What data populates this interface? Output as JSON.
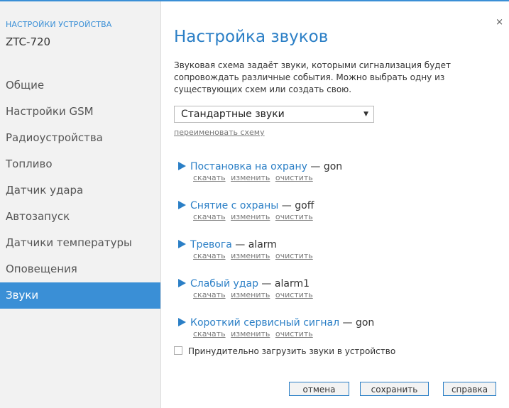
{
  "sidebar": {
    "device_settings_title": "НАСТРОЙКИ УСТРОЙСТВА",
    "device_model": "ZTC-720",
    "items": [
      {
        "label": "Общие",
        "active": false
      },
      {
        "label": "Настройки GSM",
        "active": false
      },
      {
        "label": "Радиоустройства",
        "active": false
      },
      {
        "label": "Топливо",
        "active": false
      },
      {
        "label": "Датчик удара",
        "active": false
      },
      {
        "label": "Автозапуск",
        "active": false
      },
      {
        "label": "Датчики температуры",
        "active": false
      },
      {
        "label": "Оповещения",
        "active": false
      },
      {
        "label": "Звуки",
        "active": true
      }
    ]
  },
  "main": {
    "close_symbol": "×",
    "title": "Настройка звуков",
    "description": "Звуковая схема задаёт звуки, которыми сигнализация будет сопровождать различные события. Можно выбрать одну из существующих схем или создать свою.",
    "scheme_select": {
      "value": "Стандартные звуки",
      "arrow": "▼"
    },
    "rename_link": "переименовать схему",
    "events": [
      {
        "name": "Постановка на охрану",
        "separator": " — ",
        "sound": "gon"
      },
      {
        "name": "Снятие с охраны",
        "separator": " — ",
        "sound": "goff"
      },
      {
        "name": "Тревога",
        "separator": " — ",
        "sound": "alarm"
      },
      {
        "name": "Слабый удар",
        "separator": " — ",
        "sound": "alarm1"
      },
      {
        "name": "Короткий сервисный сигнал",
        "separator": " — ",
        "sound": "gon"
      }
    ],
    "event_actions": {
      "download": "скачать",
      "edit": "изменить",
      "clear": "очистить"
    },
    "force_upload": {
      "label": "Принудительно загрузить звуки в устройство",
      "checked": false
    },
    "buttons": {
      "cancel": "отмена",
      "save": "сохранить",
      "help": "справка"
    }
  },
  "colors": {
    "accent": "#3a8fd6",
    "link": "#2b7fc6",
    "sidebar_bg": "#f2f2f2"
  }
}
